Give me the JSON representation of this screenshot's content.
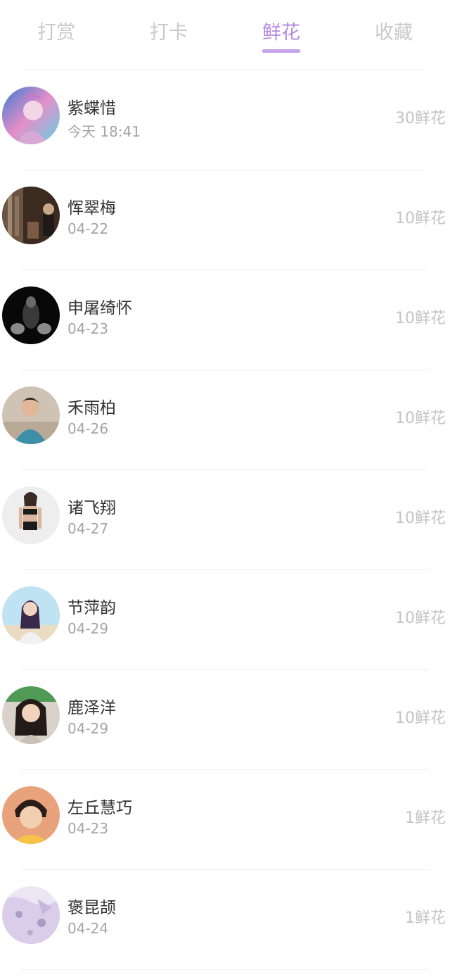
{
  "tabs": [
    {
      "label": "打赏",
      "active": false
    },
    {
      "label": "打卡",
      "active": false
    },
    {
      "label": "鲜花",
      "active": true
    },
    {
      "label": "收藏",
      "active": false
    }
  ],
  "accent_color": "#b48be0",
  "items": [
    {
      "name": "紫蝶惜",
      "date": "今天 18:41",
      "amount": "30鲜花",
      "avatar": "avatar-anime-character"
    },
    {
      "name": "恽翠梅",
      "date": "04-22",
      "amount": "10鲜花",
      "avatar": "avatar-indoor-scene"
    },
    {
      "name": "申屠绮怀",
      "date": "04-23",
      "amount": "10鲜花",
      "avatar": "avatar-dark-silhouette"
    },
    {
      "name": "禾雨柏",
      "date": "04-26",
      "amount": "10鲜花",
      "avatar": "avatar-boy-portrait"
    },
    {
      "name": "诸飞翔",
      "date": "04-27",
      "amount": "10鲜花",
      "avatar": "avatar-fitness-woman"
    },
    {
      "name": "节萍韵",
      "date": "04-29",
      "amount": "10鲜花",
      "avatar": "avatar-woman-outdoors"
    },
    {
      "name": "鹿泽洋",
      "date": "04-29",
      "amount": "10鲜花",
      "avatar": "avatar-girl-portrait"
    },
    {
      "name": "左丘慧巧",
      "date": "04-23",
      "amount": "1鲜花",
      "avatar": "avatar-child-portrait"
    },
    {
      "name": "褒昆颉",
      "date": "04-24",
      "amount": "1鲜花",
      "avatar": "avatar-purple-pattern"
    }
  ]
}
